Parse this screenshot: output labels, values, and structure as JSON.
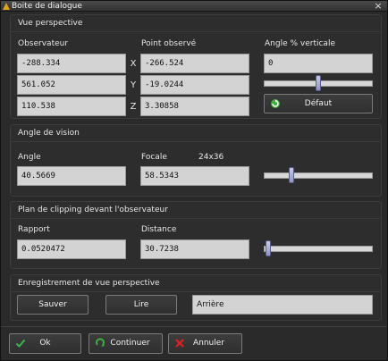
{
  "window": {
    "title": "Boite de dialogue",
    "close_glyph": "×"
  },
  "perspective": {
    "title": "Vue perspective",
    "observer_label": "Observateur",
    "target_label": "Point observé",
    "angle_label": "Angle % verticale",
    "axes": [
      "X",
      "Y",
      "Z"
    ],
    "observer": [
      "-288.334",
      "561.052",
      "110.538"
    ],
    "target": [
      "-266.524",
      "-19.0244",
      "3.30858"
    ],
    "angle_value": "0",
    "angle_slider_level": 0.5,
    "default_button": "Défaut"
  },
  "vision": {
    "title": "Angle de vision",
    "angle_label": "Angle",
    "angle_value": "40.5669",
    "focal_label": "Focale",
    "format_label": "24x36",
    "focal_value": "58.5343",
    "slider_level": 0.24
  },
  "clipping": {
    "title": "Plan de clipping devant l'observateur",
    "ratio_label": "Rapport",
    "ratio_value": "0.0520472",
    "distance_label": "Distance",
    "distance_value": "30.7238",
    "slider_level": 0.02
  },
  "record": {
    "title": "Enregistrement de vue perspective",
    "save_button": "Sauver",
    "read_button": "Lire",
    "view_value": "Arrière"
  },
  "footer": {
    "ok_button": "Ok",
    "continue_button": "Continuer",
    "cancel_button": "Annuler"
  },
  "colors": {
    "ok_icon": "#39b54a",
    "continue_icon": "#3fae3f",
    "cancel_icon": "#e02020"
  }
}
